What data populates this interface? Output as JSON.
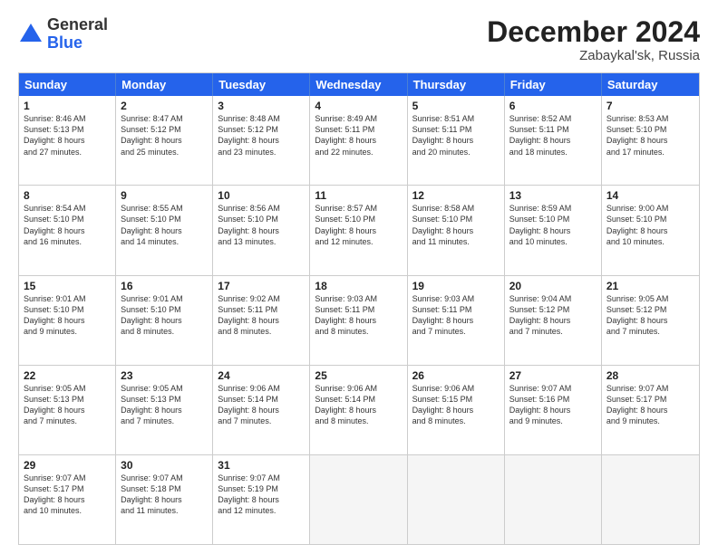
{
  "header": {
    "logo_general": "General",
    "logo_blue": "Blue",
    "month_title": "December 2024",
    "subtitle": "Zabaykal'sk, Russia"
  },
  "weekdays": [
    "Sunday",
    "Monday",
    "Tuesday",
    "Wednesday",
    "Thursday",
    "Friday",
    "Saturday"
  ],
  "rows": [
    [
      {
        "day": "1",
        "lines": [
          "Sunrise: 8:46 AM",
          "Sunset: 5:13 PM",
          "Daylight: 8 hours",
          "and 27 minutes."
        ]
      },
      {
        "day": "2",
        "lines": [
          "Sunrise: 8:47 AM",
          "Sunset: 5:12 PM",
          "Daylight: 8 hours",
          "and 25 minutes."
        ]
      },
      {
        "day": "3",
        "lines": [
          "Sunrise: 8:48 AM",
          "Sunset: 5:12 PM",
          "Daylight: 8 hours",
          "and 23 minutes."
        ]
      },
      {
        "day": "4",
        "lines": [
          "Sunrise: 8:49 AM",
          "Sunset: 5:11 PM",
          "Daylight: 8 hours",
          "and 22 minutes."
        ]
      },
      {
        "day": "5",
        "lines": [
          "Sunrise: 8:51 AM",
          "Sunset: 5:11 PM",
          "Daylight: 8 hours",
          "and 20 minutes."
        ]
      },
      {
        "day": "6",
        "lines": [
          "Sunrise: 8:52 AM",
          "Sunset: 5:11 PM",
          "Daylight: 8 hours",
          "and 18 minutes."
        ]
      },
      {
        "day": "7",
        "lines": [
          "Sunrise: 8:53 AM",
          "Sunset: 5:10 PM",
          "Daylight: 8 hours",
          "and 17 minutes."
        ]
      }
    ],
    [
      {
        "day": "8",
        "lines": [
          "Sunrise: 8:54 AM",
          "Sunset: 5:10 PM",
          "Daylight: 8 hours",
          "and 16 minutes."
        ]
      },
      {
        "day": "9",
        "lines": [
          "Sunrise: 8:55 AM",
          "Sunset: 5:10 PM",
          "Daylight: 8 hours",
          "and 14 minutes."
        ]
      },
      {
        "day": "10",
        "lines": [
          "Sunrise: 8:56 AM",
          "Sunset: 5:10 PM",
          "Daylight: 8 hours",
          "and 13 minutes."
        ]
      },
      {
        "day": "11",
        "lines": [
          "Sunrise: 8:57 AM",
          "Sunset: 5:10 PM",
          "Daylight: 8 hours",
          "and 12 minutes."
        ]
      },
      {
        "day": "12",
        "lines": [
          "Sunrise: 8:58 AM",
          "Sunset: 5:10 PM",
          "Daylight: 8 hours",
          "and 11 minutes."
        ]
      },
      {
        "day": "13",
        "lines": [
          "Sunrise: 8:59 AM",
          "Sunset: 5:10 PM",
          "Daylight: 8 hours",
          "and 10 minutes."
        ]
      },
      {
        "day": "14",
        "lines": [
          "Sunrise: 9:00 AM",
          "Sunset: 5:10 PM",
          "Daylight: 8 hours",
          "and 10 minutes."
        ]
      }
    ],
    [
      {
        "day": "15",
        "lines": [
          "Sunrise: 9:01 AM",
          "Sunset: 5:10 PM",
          "Daylight: 8 hours",
          "and 9 minutes."
        ]
      },
      {
        "day": "16",
        "lines": [
          "Sunrise: 9:01 AM",
          "Sunset: 5:10 PM",
          "Daylight: 8 hours",
          "and 8 minutes."
        ]
      },
      {
        "day": "17",
        "lines": [
          "Sunrise: 9:02 AM",
          "Sunset: 5:11 PM",
          "Daylight: 8 hours",
          "and 8 minutes."
        ]
      },
      {
        "day": "18",
        "lines": [
          "Sunrise: 9:03 AM",
          "Sunset: 5:11 PM",
          "Daylight: 8 hours",
          "and 8 minutes."
        ]
      },
      {
        "day": "19",
        "lines": [
          "Sunrise: 9:03 AM",
          "Sunset: 5:11 PM",
          "Daylight: 8 hours",
          "and 7 minutes."
        ]
      },
      {
        "day": "20",
        "lines": [
          "Sunrise: 9:04 AM",
          "Sunset: 5:12 PM",
          "Daylight: 8 hours",
          "and 7 minutes."
        ]
      },
      {
        "day": "21",
        "lines": [
          "Sunrise: 9:05 AM",
          "Sunset: 5:12 PM",
          "Daylight: 8 hours",
          "and 7 minutes."
        ]
      }
    ],
    [
      {
        "day": "22",
        "lines": [
          "Sunrise: 9:05 AM",
          "Sunset: 5:13 PM",
          "Daylight: 8 hours",
          "and 7 minutes."
        ]
      },
      {
        "day": "23",
        "lines": [
          "Sunrise: 9:05 AM",
          "Sunset: 5:13 PM",
          "Daylight: 8 hours",
          "and 7 minutes."
        ]
      },
      {
        "day": "24",
        "lines": [
          "Sunrise: 9:06 AM",
          "Sunset: 5:14 PM",
          "Daylight: 8 hours",
          "and 7 minutes."
        ]
      },
      {
        "day": "25",
        "lines": [
          "Sunrise: 9:06 AM",
          "Sunset: 5:14 PM",
          "Daylight: 8 hours",
          "and 8 minutes."
        ]
      },
      {
        "day": "26",
        "lines": [
          "Sunrise: 9:06 AM",
          "Sunset: 5:15 PM",
          "Daylight: 8 hours",
          "and 8 minutes."
        ]
      },
      {
        "day": "27",
        "lines": [
          "Sunrise: 9:07 AM",
          "Sunset: 5:16 PM",
          "Daylight: 8 hours",
          "and 9 minutes."
        ]
      },
      {
        "day": "28",
        "lines": [
          "Sunrise: 9:07 AM",
          "Sunset: 5:17 PM",
          "Daylight: 8 hours",
          "and 9 minutes."
        ]
      }
    ],
    [
      {
        "day": "29",
        "lines": [
          "Sunrise: 9:07 AM",
          "Sunset: 5:17 PM",
          "Daylight: 8 hours",
          "and 10 minutes."
        ]
      },
      {
        "day": "30",
        "lines": [
          "Sunrise: 9:07 AM",
          "Sunset: 5:18 PM",
          "Daylight: 8 hours",
          "and 11 minutes."
        ]
      },
      {
        "day": "31",
        "lines": [
          "Sunrise: 9:07 AM",
          "Sunset: 5:19 PM",
          "Daylight: 8 hours",
          "and 12 minutes."
        ]
      },
      {
        "day": "",
        "lines": []
      },
      {
        "day": "",
        "lines": []
      },
      {
        "day": "",
        "lines": []
      },
      {
        "day": "",
        "lines": []
      }
    ]
  ]
}
